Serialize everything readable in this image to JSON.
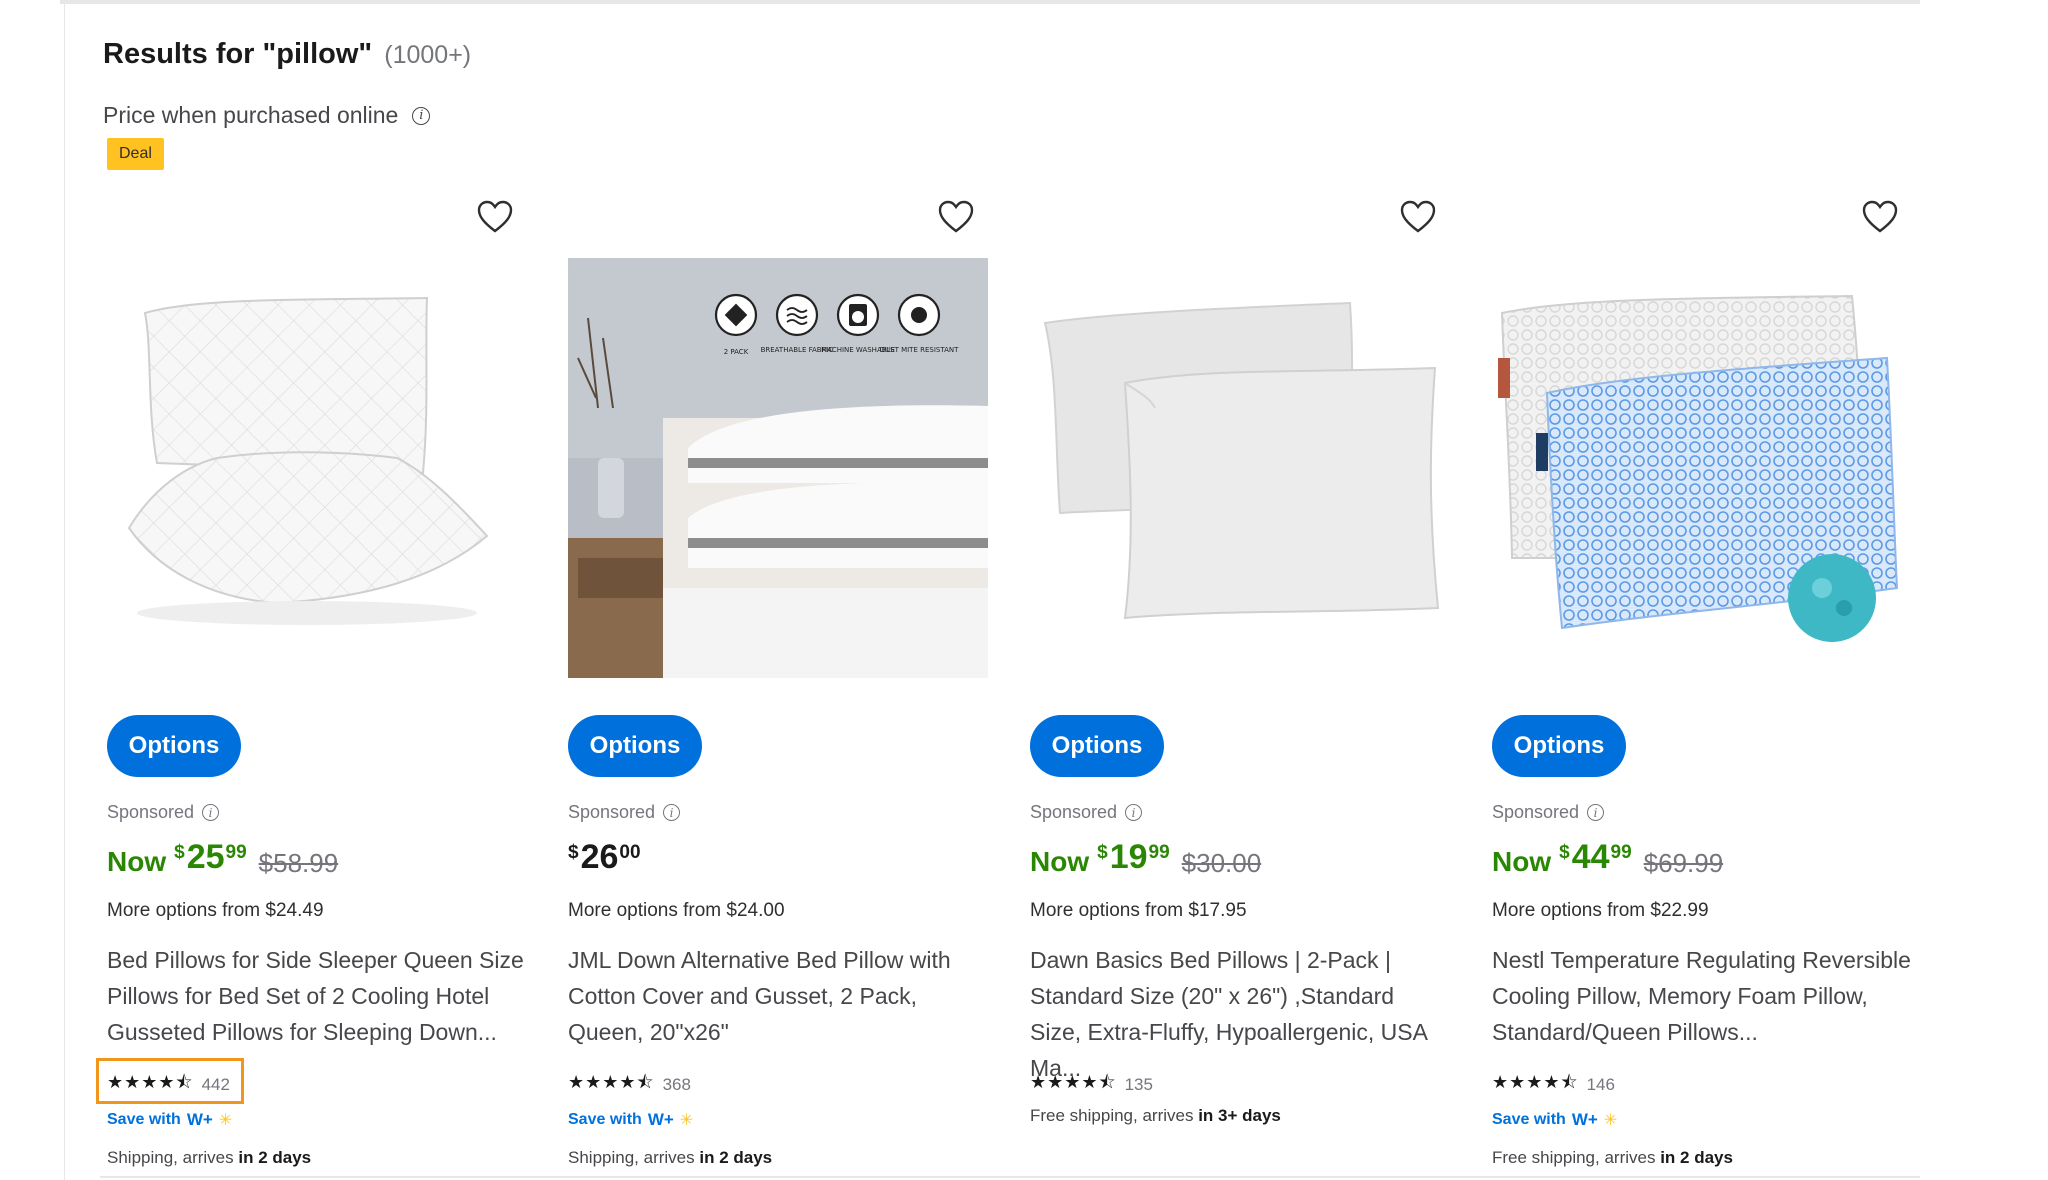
{
  "header": {
    "results_prefix": "Results for \"pillow\"",
    "results_count": "(1000+)",
    "price_note": "Price when purchased online",
    "deal_badge": "Deal"
  },
  "colors": {
    "primary_blue": "#0071dc",
    "price_green": "#2a8703",
    "deal_yellow": "#ffc220",
    "highlight_orange": "#f0961a"
  },
  "products": [
    {
      "image_icon": "white-quilted-pillows-image",
      "options_label": "Options",
      "sponsored": "Sponsored",
      "now_label": "Now",
      "price_symbol": "$",
      "price_dollars": "25",
      "price_cents": "99",
      "was_price": "$58.99",
      "more_options": "More options from $24.49",
      "title": "Bed Pillows for Side Sleeper Queen Size Pillows for Bed Set of 2 Cooling Hotel Gusseted Pillows for Sleeping Down...",
      "stars": "★★★★⯪",
      "rating": 4.5,
      "reviews": "442",
      "save_with": "Save with",
      "wplus": "W+",
      "shipping_prefix": "Shipping, arrives",
      "shipping_bold": "in 2 days"
    },
    {
      "image_icon": "stacked-pillows-bedroom-image",
      "image_feature_labels": [
        "2 PACK",
        "BREATHABLE FABRIC",
        "MACHINE WASHABLE",
        "DUST MITE RESISTANT"
      ],
      "options_label": "Options",
      "sponsored": "Sponsored",
      "now_label": "",
      "price_symbol": "$",
      "price_dollars": "26",
      "price_cents": "00",
      "was_price": "",
      "more_options": "More options from $24.00",
      "title": "JML Down Alternative Bed Pillow with Cotton Cover and Gusset, 2 Pack, Queen, 20\"x26\"",
      "stars": "★★★★⯪",
      "rating": 4.5,
      "reviews": "368",
      "save_with": "Save with",
      "wplus": "W+",
      "shipping_prefix": "Shipping, arrives",
      "shipping_bold": "in 2 days"
    },
    {
      "image_icon": "two-plain-white-pillows-image",
      "options_label": "Options",
      "sponsored": "Sponsored",
      "now_label": "Now",
      "price_symbol": "$",
      "price_dollars": "19",
      "price_cents": "99",
      "was_price": "$30.00",
      "more_options": "More options from $17.95",
      "title": "Dawn Basics Bed Pillows | 2-Pack | Standard Size (20\" x 26\") ,Standard Size, Extra-Fluffy, Hypoallergenic, USA Ma...",
      "stars": "★★★★⯪",
      "rating": 4.5,
      "reviews": "135",
      "save_with": "",
      "wplus": "",
      "shipping_prefix": "Free shipping, arrives",
      "shipping_bold": "in 3+ days"
    },
    {
      "image_icon": "blue-cooling-pillow-image",
      "options_label": "Options",
      "sponsored": "Sponsored",
      "now_label": "Now",
      "price_symbol": "$",
      "price_dollars": "44",
      "price_cents": "99",
      "was_price": "$69.99",
      "more_options": "More options from $22.99",
      "title": "Nestl Temperature Regulating Reversible Cooling Pillow, Memory Foam Pillow, Standard/Queen Pillows...",
      "stars": "★★★★⯪",
      "rating": 4.5,
      "reviews": "146",
      "save_with": "Save with",
      "wplus": "W+",
      "shipping_prefix": "Free shipping, arrives",
      "shipping_bold": "in 2 days"
    }
  ]
}
